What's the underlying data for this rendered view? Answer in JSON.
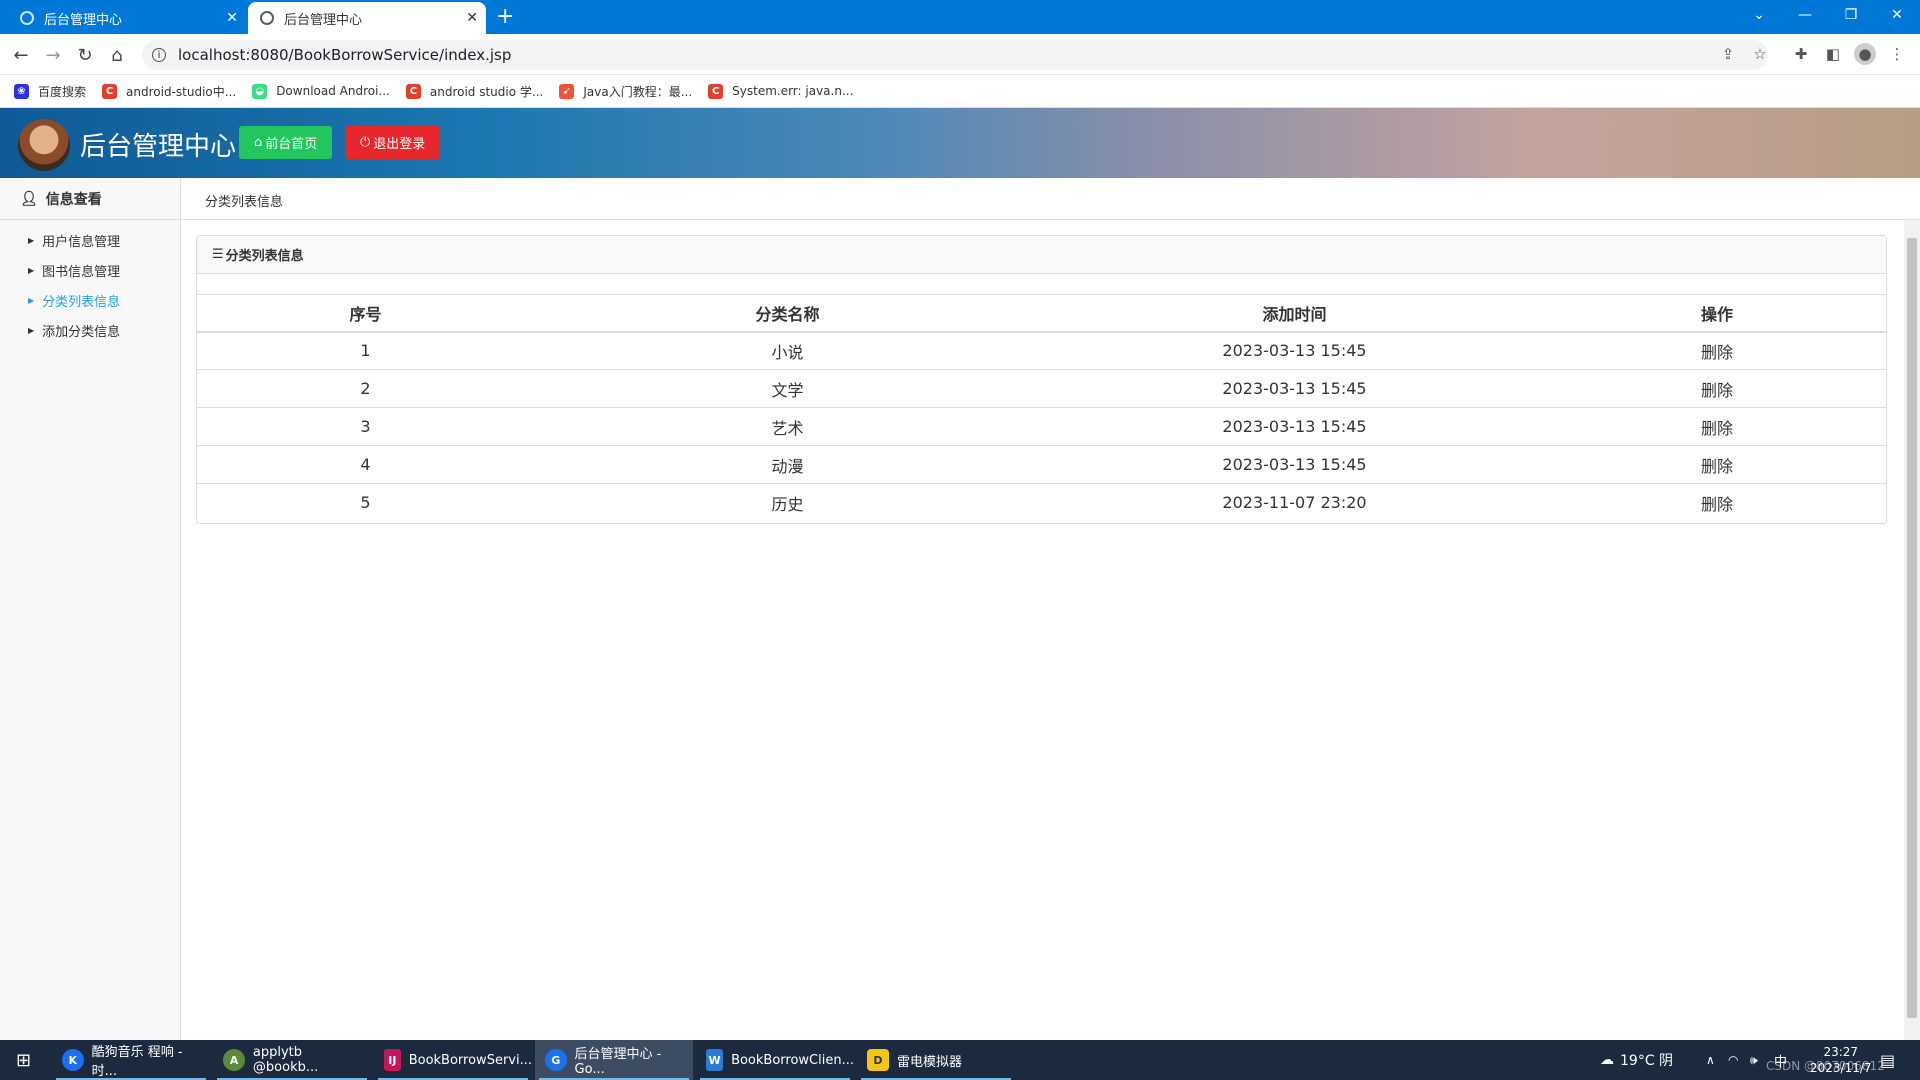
{
  "browser": {
    "tabs": [
      {
        "title": "后台管理中心",
        "active": false
      },
      {
        "title": "后台管理中心",
        "active": true
      }
    ],
    "new_tab": "+",
    "url": "localhost:8080/BookBorrowService/index.jsp",
    "bookmarks": [
      {
        "label": "百度搜索",
        "icon": "paw-icon",
        "color": "#2932e1"
      },
      {
        "label": "android-studio中...",
        "icon": "c-logo-icon",
        "color": "#e1412c"
      },
      {
        "label": "Download Androi...",
        "icon": "android-icon",
        "color": "#3ddc84"
      },
      {
        "label": "android studio 学...",
        "icon": "c-logo-icon",
        "color": "#e1412c"
      },
      {
        "label": "Java入门教程：最...",
        "icon": "swift-icon",
        "color": "#f05138"
      },
      {
        "label": "System.err: java.n...",
        "icon": "c-logo-icon",
        "color": "#e1412c"
      }
    ]
  },
  "app": {
    "brand": "后台管理中心",
    "home_button": "前台首页",
    "logout_button": "退出登录",
    "colors": {
      "home": "#22c55e",
      "logout": "#e8262d",
      "active_link": "#2a9fd6"
    }
  },
  "sidebar": {
    "header": "信息查看",
    "items": [
      {
        "label": "用户信息管理",
        "active": false
      },
      {
        "label": "图书信息管理",
        "active": false
      },
      {
        "label": "分类列表信息",
        "active": true
      },
      {
        "label": "添加分类信息",
        "active": false
      }
    ]
  },
  "breadcrumb": "分类列表信息",
  "panel": {
    "title": "分类列表信息",
    "columns": [
      "序号",
      "分类名称",
      "添加时间",
      "操作"
    ],
    "rows": [
      {
        "id": "1",
        "name": "小说",
        "time": "2023-03-13 15:45",
        "action": "删除"
      },
      {
        "id": "2",
        "name": "文学",
        "time": "2023-03-13 15:45",
        "action": "删除"
      },
      {
        "id": "3",
        "name": "艺术",
        "time": "2023-03-13 15:45",
        "action": "删除"
      },
      {
        "id": "4",
        "name": "动漫",
        "time": "2023-03-13 15:45",
        "action": "删除"
      },
      {
        "id": "5",
        "name": "历史",
        "time": "2023-11-07 23:20",
        "action": "删除"
      }
    ]
  },
  "taskbar": {
    "apps": [
      {
        "label": "酷狗音乐 程响 - 时...",
        "color": "#1e6ef2",
        "letter": "K"
      },
      {
        "label": "applytb @bookb...",
        "color": "#5a8a3a",
        "letter": "A"
      },
      {
        "label": "BookBorrowServi...",
        "color": "#c2185b",
        "letter": "IJ"
      },
      {
        "label": "后台管理中心 - Go...",
        "color": "#1a73e8",
        "letter": "G",
        "active": true
      },
      {
        "label": "BookBorrowClien...",
        "color": "#2b7cd3",
        "letter": "W"
      },
      {
        "label": "雷电模拟器",
        "color": "#f5c518",
        "letter": "D"
      }
    ],
    "weather": "19°C 阴",
    "ime": "中",
    "time": "23:27",
    "date": "2023/11/7",
    "watermark": "CSDN @807006812"
  }
}
